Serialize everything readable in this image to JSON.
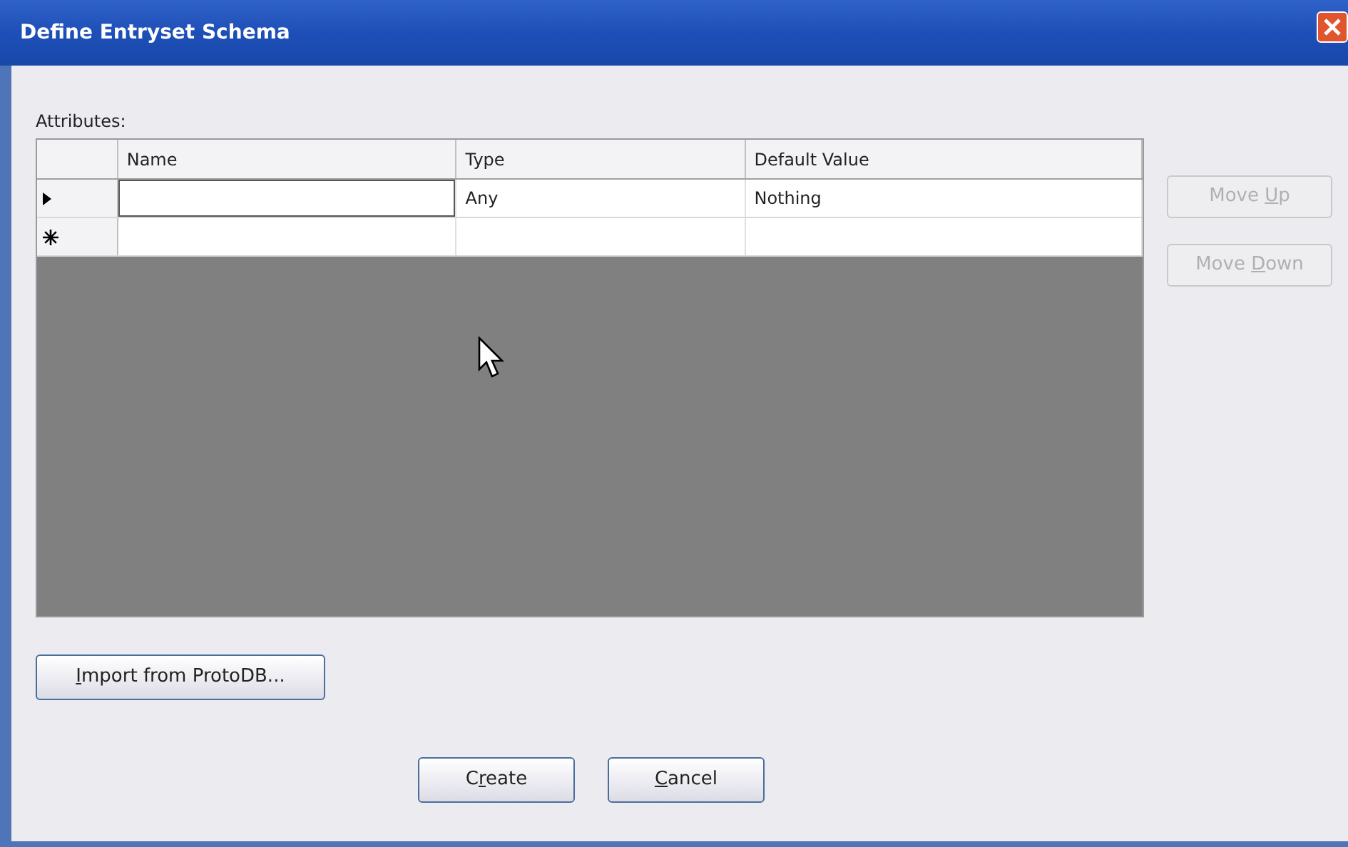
{
  "window": {
    "title": "Define Entryset Schema"
  },
  "attributes_label": "Attributes:",
  "table": {
    "columns": [
      "Name",
      "Type",
      "Default Value"
    ],
    "rows": [
      {
        "kind": "current",
        "editing": true,
        "cells": [
          "",
          "Any",
          "Nothing"
        ]
      },
      {
        "kind": "new",
        "editing": false,
        "cells": [
          "",
          "",
          ""
        ]
      }
    ]
  },
  "side_buttons": [
    {
      "pre": "Move ",
      "key": "U",
      "post": "p",
      "disabled": true
    },
    {
      "pre": "Move ",
      "key": "D",
      "post": "own",
      "disabled": true
    }
  ],
  "import_button": {
    "key": "I",
    "post": "mport from ProtoDB...",
    "disabled": false
  },
  "buttons": [
    {
      "pre": "C",
      "key": "r",
      "post": "eate",
      "disabled": false
    },
    {
      "key": "C",
      "post": "ancel",
      "disabled": false
    }
  ]
}
